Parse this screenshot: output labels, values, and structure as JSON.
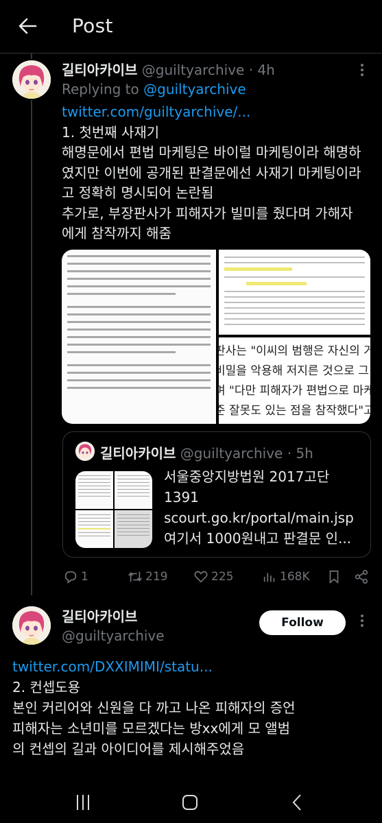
{
  "header": {
    "title": "Post",
    "back_icon": "arrow-left-icon"
  },
  "tweet1": {
    "display_name": "길티아카이브",
    "handle": "@guiltyarchive",
    "time": "· 4h",
    "replying_prefix": "Replying to ",
    "replying_handle": "@guiltyarchive",
    "link": "twitter.com/guiltyarchive/...",
    "lines": [
      "1. 첫번째 사재기",
      "해명문에서 편법 마케팅은 바이럴 마케팅이라 해명하",
      "였지만 이번에 공개된 판결문에선 사재기 마케팅이라",
      "고 정확히 명시되어 논란됨",
      "추가로, 부장판사가 피해자가 빌미를 줬다며 가해자",
      "에게 참작까지 해줌"
    ],
    "media": {
      "quote_lines": [
        "판사는 \"이씨의 범행은 자신의 거래처",
        "비밀을 악용해 저지른 것으로 그 죄질",
        "며 \"다만 피해자가 편법으로 마케팅하",
        "준 잘못도 있는 점을 참작했다\"고 설명"
      ]
    },
    "quoted": {
      "display_name": "길티아카이브",
      "handle": "@guiltyarchive",
      "time": "· 5h",
      "lines": [
        "서울중앙지방법원 2017고단",
        "1391",
        "scourt.go.kr/portal/main.jsp",
        "여기서 1000원내고 판결문 인..."
      ]
    },
    "actions": {
      "replies": "1",
      "retweets": "219",
      "likes": "225",
      "views": "168K"
    }
  },
  "tweet2": {
    "display_name": "길티아카이브",
    "handle": "@guiltyarchive",
    "follow_label": "Follow",
    "link": "twitter.com/DXXIMIMI/statu...",
    "lines": [
      "2. 컨셉도용",
      "본인 커리어와 신원을 다 까고 나온 피해자의 증언",
      "피해자는 소년미를 모르겠다는 방xx에게 모 앨범",
      "의 컨셉의 길과 아이디어를 제시해주었음"
    ]
  },
  "colors": {
    "accent": "#1d9bf0",
    "muted": "#71767b",
    "text": "#e7e9ea",
    "background": "#000000",
    "highlight": "#e9e146"
  }
}
